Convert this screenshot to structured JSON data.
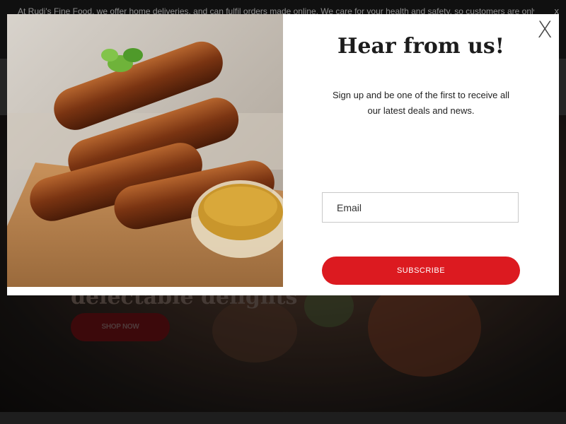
{
  "announcement": {
    "text": "At Rudi's Fine Food, we offer home deliveries, and can fulfil orders made online. We care for your health and safety, so customers are only",
    "close_label": "x"
  },
  "hero": {
    "title": "delectable delights",
    "button_label": "SHOP NOW"
  },
  "modal": {
    "close_label": "X",
    "title": "Hear from us!",
    "description": "Sign up and be one of the first to receive all our latest deals and news.",
    "email_placeholder": "Email",
    "subscribe_label": "SUBSCRIBE",
    "image_alt": "grilled-sausages-with-mustard"
  },
  "colors": {
    "accent": "#dc1a20",
    "overlay": "rgba(0,0,0,0.35)"
  }
}
